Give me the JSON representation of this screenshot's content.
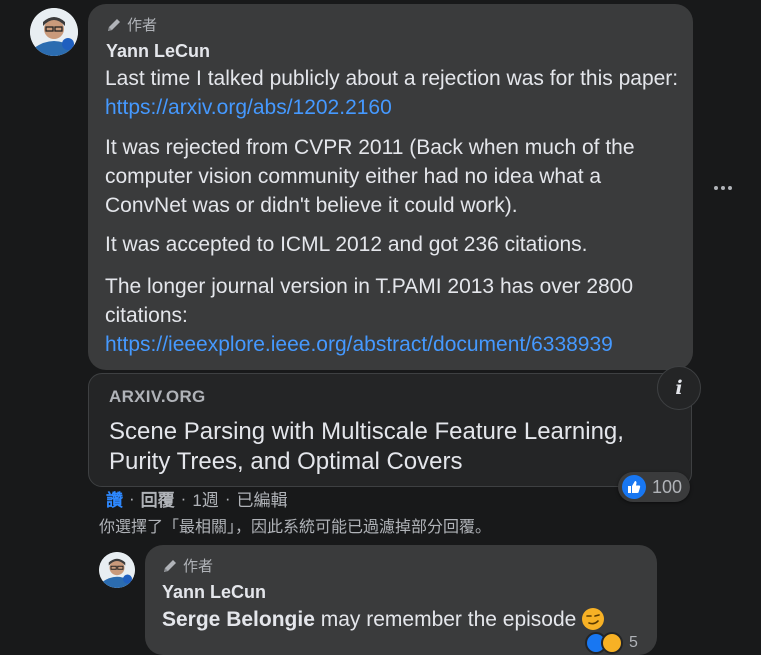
{
  "comment": {
    "author_tag": "作者",
    "author_name": "Yann LeCun",
    "paragraphs": {
      "p1_text": "Last time I talked publicly about a rejection was for this paper: ",
      "p1_link": "https://arxiv.org/abs/1202.2160",
      "p2": "It was rejected from CVPR 2011 (Back when much of the computer vision community either had no idea what a ConvNet was or didn't believe it could work).",
      "p3": "It was accepted to ICML 2012 and got 236 citations.",
      "p4_text": "The longer journal version in T.PAMI 2013 has over 2800 citations: ",
      "p4_link": "https://ieeexplore.ieee.org/abstract/document/6338939"
    },
    "link_preview": {
      "domain": "ARXIV.ORG",
      "title": "Scene Parsing with Multiscale Feature Learning, Purity Trees, and Optimal Covers",
      "info_glyph": "i"
    },
    "reactions": {
      "count": "100",
      "icon": "thumbs-up-icon"
    },
    "actions": {
      "like": "讚",
      "reply": "回覆",
      "sep": "·",
      "time": "1週",
      "edited": "已編輯"
    },
    "more_icon": "more-options-icon"
  },
  "filter_note": "你選擇了「最相關」，因此系統可能已過濾掉部分回覆。",
  "reply": {
    "author_tag": "作者",
    "author_name": "Yann LeCun",
    "mention": "Serge Belongie",
    "text": " may remember the episode ",
    "emoji": "smirking-face-emoji",
    "reaction_count": "5"
  },
  "colors": {
    "background": "#18191a",
    "bubble": "#3a3b3c",
    "link": "#4599ff",
    "like_blue": "#1877f2",
    "muted": "#b0b3b8",
    "text": "#e4e6eb"
  }
}
